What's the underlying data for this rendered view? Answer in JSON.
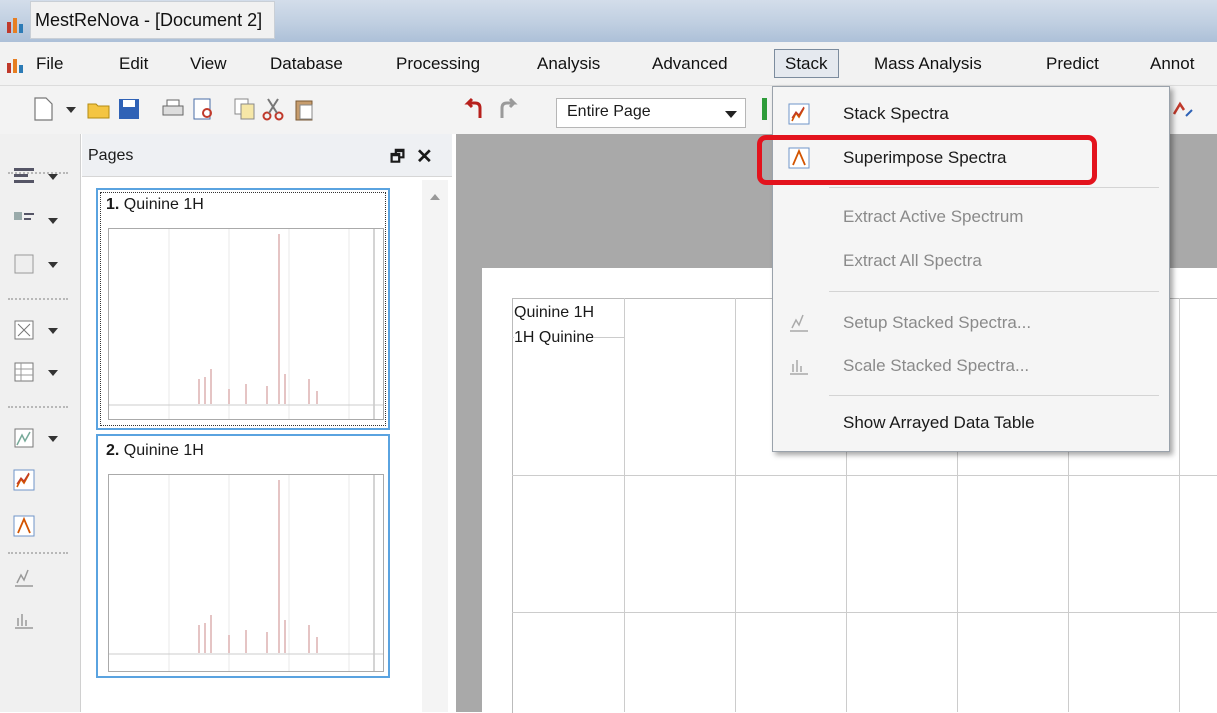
{
  "window": {
    "title": "MestReNova - [Document 2]"
  },
  "menubar": {
    "items": [
      "File",
      "Edit",
      "View",
      "Database",
      "Processing",
      "Analysis",
      "Advanced",
      "Stack",
      "Mass Analysis",
      "Predict",
      "Annot"
    ]
  },
  "toolbar": {
    "zoom_value": "Entire Page"
  },
  "pages_panel": {
    "title": "Pages",
    "float_glyph": "🗗",
    "close_glyph": "✕",
    "thumbs": [
      {
        "number": "1.",
        "name": "Quinine 1H"
      },
      {
        "number": "2.",
        "name": "Quinine 1H"
      }
    ]
  },
  "document": {
    "spectrum_label_1": "Quinine 1H",
    "spectrum_label_2": "1H Quinine"
  },
  "stack_menu": {
    "items": [
      {
        "label": "Stack Spectra",
        "icon": "stack-spectra-icon",
        "enabled": true
      },
      {
        "label": "Superimpose Spectra",
        "icon": "superimpose-spectra-icon",
        "enabled": true,
        "highlighted": true
      },
      {
        "label": "Extract Active Spectrum",
        "enabled": false
      },
      {
        "label": "Extract All Spectra",
        "enabled": false
      },
      {
        "label": "Setup Stacked Spectra...",
        "icon": "setup-stacked-icon",
        "enabled": false
      },
      {
        "label": "Scale Stacked Spectra...",
        "icon": "scale-stacked-icon",
        "enabled": false
      },
      {
        "label": "Show Arrayed Data Table",
        "enabled": true
      }
    ]
  },
  "colors": {
    "highlight": "#e3131d",
    "thumb_border": "#5aa3e0",
    "canvas_bg": "#a9a9a9"
  }
}
